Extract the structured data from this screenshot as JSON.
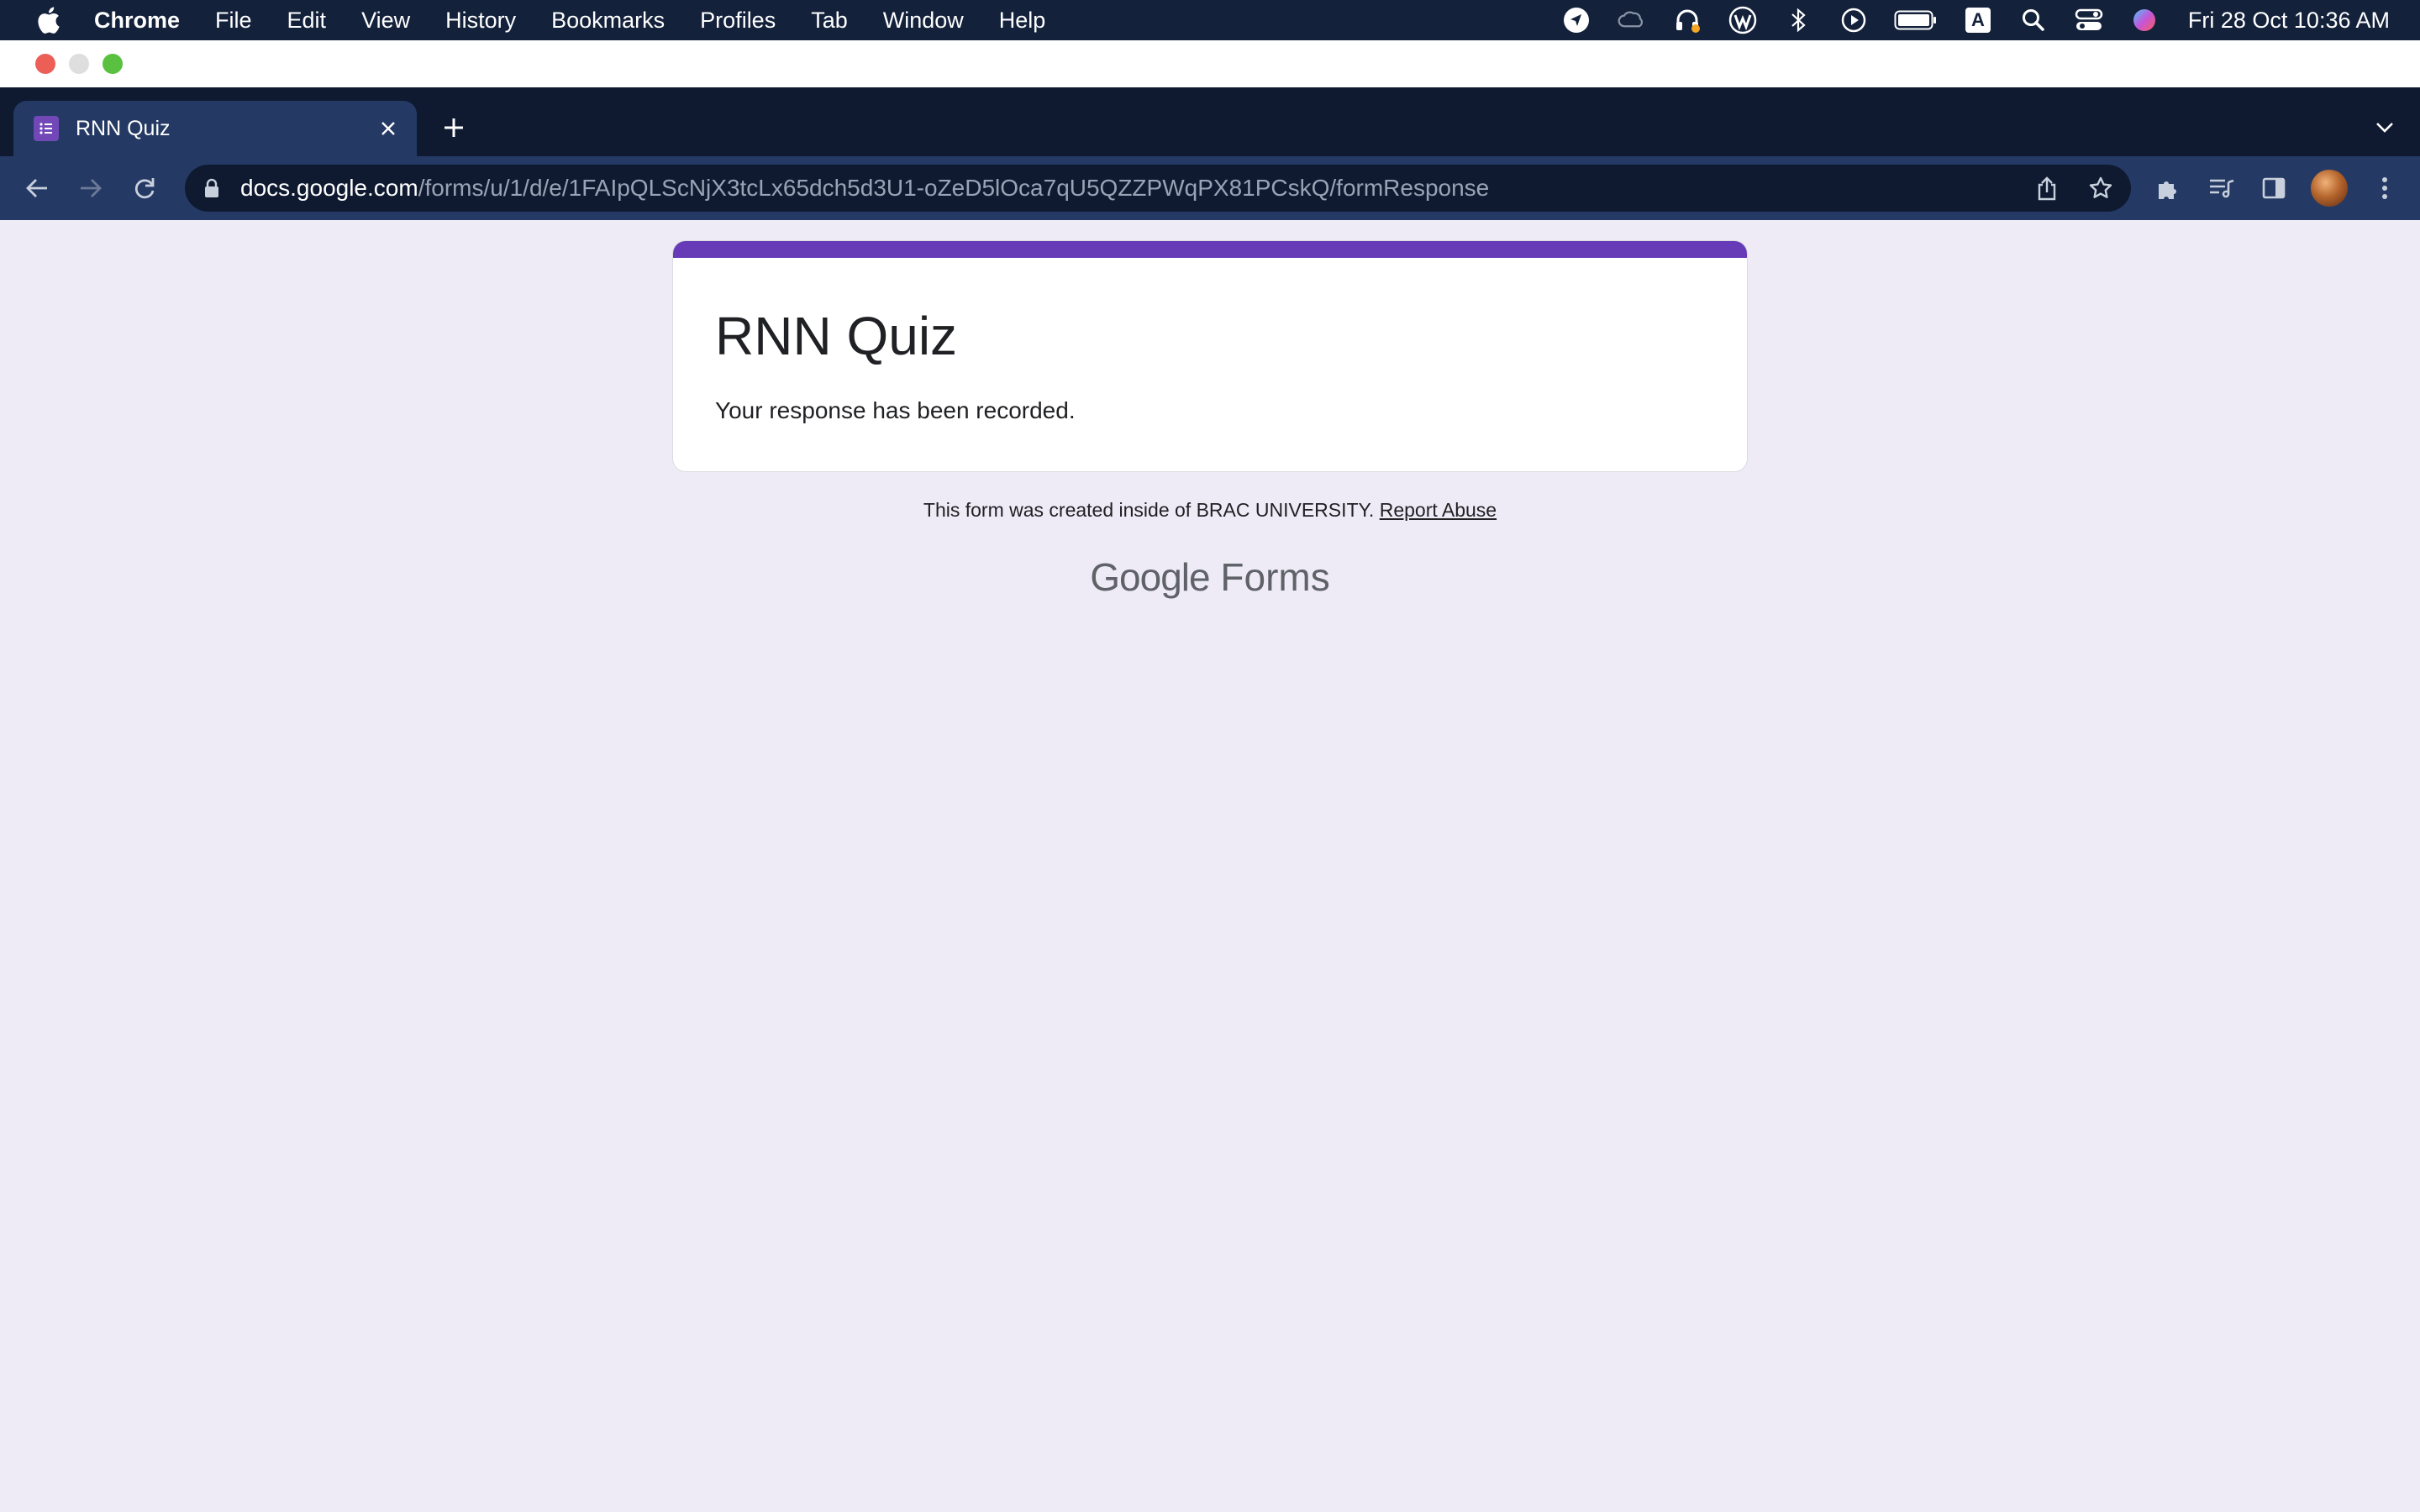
{
  "menubar": {
    "app": "Chrome",
    "items": [
      "File",
      "Edit",
      "View",
      "History",
      "Bookmarks",
      "Profiles",
      "Tab",
      "Window",
      "Help"
    ],
    "clock": "Fri 28 Oct  10:36 AM",
    "status_icons": [
      "location-arrow-icon",
      "creative-cloud-icon",
      "headphones-icon",
      "wordpress-icon",
      "bluetooth-icon",
      "play-icon",
      "battery-icon",
      "input-source-icon",
      "spotlight-search-icon",
      "control-center-icon",
      "siri-icon"
    ],
    "input_source_letter": "A"
  },
  "tab": {
    "title": "RNN Quiz",
    "favicon": "forms-icon"
  },
  "omnibox": {
    "host": "docs.google.com",
    "path": "/forms/u/1/d/e/1FAIpQLScNjX3tcLx65dch5d3U1-oZeD5lOca7qU5QZZPWqPX81PCskQ/formResponse"
  },
  "form": {
    "title": "RNN Quiz",
    "message": "Your response has been recorded."
  },
  "footer": {
    "text": "This form was created inside of BRAC UNIVERSITY.",
    "link": "Report Abuse"
  },
  "brand": {
    "google": "Google",
    "forms": "Forms"
  },
  "colors": {
    "accent": "#673ab7",
    "page_bg": "#efebf6",
    "toolbar": "#243a64",
    "menubar": "#13213b"
  }
}
